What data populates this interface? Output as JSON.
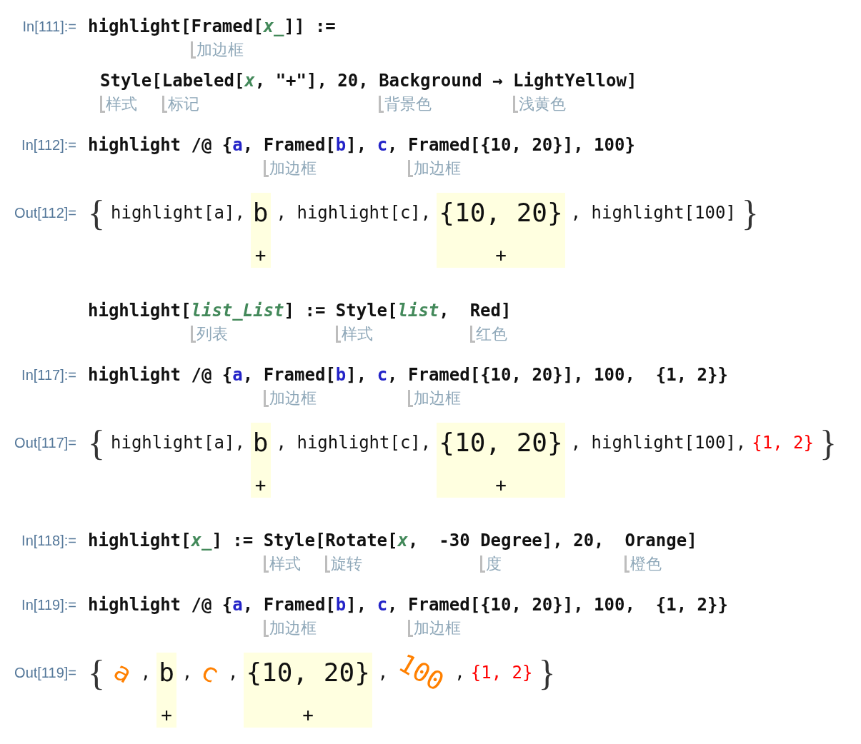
{
  "cells": [
    {
      "kind": "input",
      "label": "In[111]:=",
      "lines": [
        [
          {
            "kind": "plain",
            "text": "highlight["
          },
          {
            "kind": "plain",
            "text": "Framed",
            "hint": "加边框"
          },
          {
            "kind": "plain",
            "text": "["
          },
          {
            "kind": "pattern",
            "text": "x_"
          },
          {
            "kind": "plain",
            "text": "]] :="
          }
        ],
        [
          {
            "kind": "plain",
            "text": "Style",
            "hint": "样式"
          },
          {
            "kind": "plain",
            "text": "["
          },
          {
            "kind": "plain",
            "text": "Labeled",
            "hint": "标记"
          },
          {
            "kind": "plain",
            "text": "["
          },
          {
            "kind": "pattern",
            "text": "x"
          },
          {
            "kind": "plain",
            "text": ", \"+\"], 20, "
          },
          {
            "kind": "plain",
            "text": "Background",
            "hint": "背景色"
          },
          {
            "kind": "plain",
            "text": " → "
          },
          {
            "kind": "plain",
            "text": "LightYellow",
            "hint": "浅黄色"
          },
          {
            "kind": "plain",
            "text": "]"
          }
        ]
      ]
    },
    {
      "kind": "input",
      "label": "In[112]:=",
      "lines": [
        [
          {
            "kind": "plain",
            "text": "highlight /@ {"
          },
          {
            "kind": "symbol",
            "text": "a"
          },
          {
            "kind": "plain",
            "text": ", "
          },
          {
            "kind": "plain",
            "text": "Framed",
            "hint": "加边框"
          },
          {
            "kind": "plain",
            "text": "["
          },
          {
            "kind": "symbol",
            "text": "b"
          },
          {
            "kind": "plain",
            "text": "], "
          },
          {
            "kind": "symbol",
            "text": "c"
          },
          {
            "kind": "plain",
            "text": ", "
          },
          {
            "kind": "plain",
            "text": "Framed",
            "hint": "加边框"
          },
          {
            "kind": "plain",
            "text": "[{10, 20}], 100}"
          }
        ]
      ]
    },
    {
      "kind": "output",
      "label": "Out[112]=",
      "items": [
        {
          "kind": "brace",
          "text": "{"
        },
        {
          "kind": "text",
          "text": "highlight[a],"
        },
        {
          "kind": "labeled",
          "text": "b",
          "label": "+"
        },
        {
          "kind": "text",
          "text": ", highlight[c],"
        },
        {
          "kind": "labeled",
          "text": "{10, 20}",
          "label": "+"
        },
        {
          "kind": "text",
          "text": ", highlight[100]"
        },
        {
          "kind": "brace",
          "text": "}"
        }
      ]
    },
    {
      "kind": "input",
      "lines": [
        [
          {
            "kind": "plain",
            "text": "highlight["
          },
          {
            "kind": "pattern",
            "text": "list_List",
            "hint": "列表"
          },
          {
            "kind": "plain",
            "text": "] := "
          },
          {
            "kind": "plain",
            "text": "Style",
            "hint": "样式"
          },
          {
            "kind": "plain",
            "text": "["
          },
          {
            "kind": "pattern",
            "text": "list"
          },
          {
            "kind": "plain",
            "text": ",  "
          },
          {
            "kind": "plain",
            "text": "Red",
            "hint": "红色"
          },
          {
            "kind": "plain",
            "text": "]"
          }
        ]
      ]
    },
    {
      "kind": "input",
      "label": "In[117]:=",
      "lines": [
        [
          {
            "kind": "plain",
            "text": "highlight /@ {"
          },
          {
            "kind": "symbol",
            "text": "a"
          },
          {
            "kind": "plain",
            "text": ", "
          },
          {
            "kind": "plain",
            "text": "Framed",
            "hint": "加边框"
          },
          {
            "kind": "plain",
            "text": "["
          },
          {
            "kind": "symbol",
            "text": "b"
          },
          {
            "kind": "plain",
            "text": "], "
          },
          {
            "kind": "symbol",
            "text": "c"
          },
          {
            "kind": "plain",
            "text": ", "
          },
          {
            "kind": "plain",
            "text": "Framed",
            "hint": "加边框"
          },
          {
            "kind": "plain",
            "text": "[{10, 20}], 100,  {1, 2}}"
          }
        ]
      ]
    },
    {
      "kind": "output",
      "label": "Out[117]=",
      "items": [
        {
          "kind": "brace",
          "text": "{"
        },
        {
          "kind": "text",
          "text": "highlight[a],"
        },
        {
          "kind": "labeled",
          "text": "b",
          "label": "+"
        },
        {
          "kind": "text",
          "text": ", highlight[c],"
        },
        {
          "kind": "labeled",
          "text": "{10, 20}",
          "label": "+"
        },
        {
          "kind": "text",
          "text": ", highlight[100],"
        },
        {
          "kind": "styled",
          "text": "{1, 2}",
          "color": "#ff0000"
        },
        {
          "kind": "brace",
          "text": "}"
        }
      ]
    },
    {
      "kind": "input",
      "label": "In[118]:=",
      "lines": [
        [
          {
            "kind": "plain",
            "text": "highlight["
          },
          {
            "kind": "pattern",
            "text": "x_"
          },
          {
            "kind": "plain",
            "text": "] := "
          },
          {
            "kind": "plain",
            "text": "Style",
            "hint": "样式"
          },
          {
            "kind": "plain",
            "text": "["
          },
          {
            "kind": "plain",
            "text": "Rotate",
            "hint": "旋转"
          },
          {
            "kind": "plain",
            "text": "["
          },
          {
            "kind": "pattern",
            "text": "x"
          },
          {
            "kind": "plain",
            "text": ",  -30 "
          },
          {
            "kind": "plain",
            "text": "Degree",
            "hint": "度"
          },
          {
            "kind": "plain",
            "text": "], 20,  "
          },
          {
            "kind": "plain",
            "text": "Orange",
            "hint": "橙色"
          },
          {
            "kind": "plain",
            "text": "]"
          }
        ]
      ]
    },
    {
      "kind": "input",
      "label": "In[119]:=",
      "lines": [
        [
          {
            "kind": "plain",
            "text": "highlight /@ {"
          },
          {
            "kind": "symbol",
            "text": "a"
          },
          {
            "kind": "plain",
            "text": ", "
          },
          {
            "kind": "plain",
            "text": "Framed",
            "hint": "加边框"
          },
          {
            "kind": "plain",
            "text": "["
          },
          {
            "kind": "symbol",
            "text": "b"
          },
          {
            "kind": "plain",
            "text": "], "
          },
          {
            "kind": "symbol",
            "text": "c"
          },
          {
            "kind": "plain",
            "text": ", "
          },
          {
            "kind": "plain",
            "text": "Framed",
            "hint": "加边框"
          },
          {
            "kind": "plain",
            "text": "[{10, 20}], 100,  {1, 2}}"
          }
        ]
      ]
    },
    {
      "kind": "output",
      "label": "Out[119]=",
      "items": [
        {
          "kind": "brace",
          "text": "{"
        },
        {
          "kind": "rotated",
          "text": "a",
          "color": "#ff8000"
        },
        {
          "kind": "text",
          "text": ","
        },
        {
          "kind": "labeled",
          "text": "b",
          "label": "+"
        },
        {
          "kind": "text",
          "text": ","
        },
        {
          "kind": "rotated",
          "text": "c",
          "color": "#ff8000"
        },
        {
          "kind": "text",
          "text": ","
        },
        {
          "kind": "labeled",
          "text": "{10, 20}",
          "label": "+"
        },
        {
          "kind": "text",
          "text": ","
        },
        {
          "kind": "rotated",
          "text": "100",
          "color": "#ff8000"
        },
        {
          "kind": "text",
          "text": ","
        },
        {
          "kind": "styled",
          "text": "{1, 2}",
          "color": "#ff0000"
        },
        {
          "kind": "brace",
          "text": "}"
        }
      ]
    }
  ]
}
